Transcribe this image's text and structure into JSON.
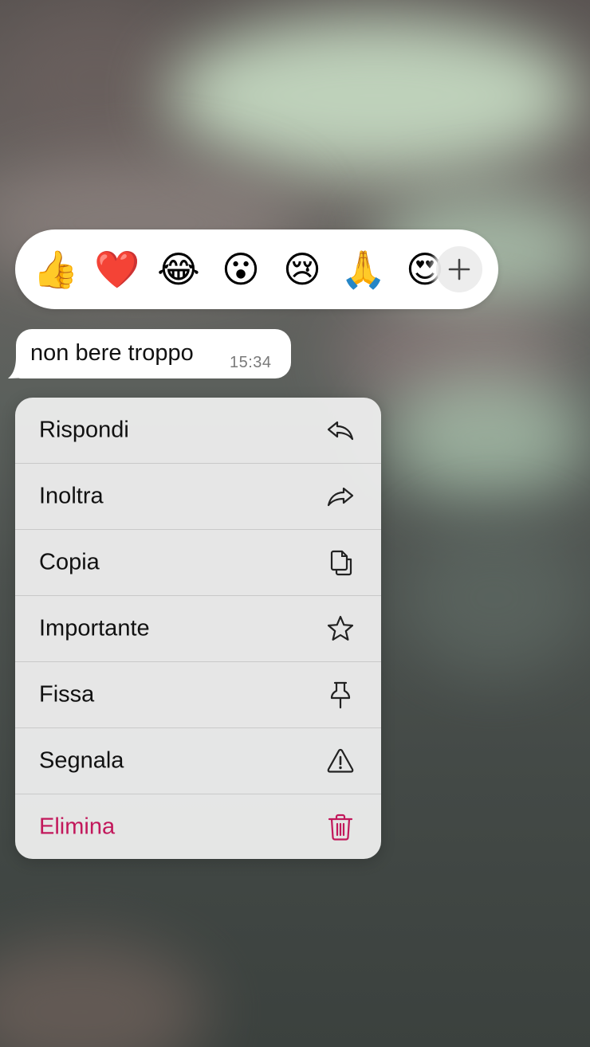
{
  "reactions": {
    "emojis": [
      "👍",
      "❤️",
      "😂",
      "😮",
      "😢",
      "🙏",
      "😍"
    ],
    "more_icon": "plus-icon"
  },
  "message": {
    "text": "non bere troppo",
    "time": "15:34"
  },
  "menu": {
    "items": [
      {
        "label": "Rispondi",
        "icon": "reply-icon"
      },
      {
        "label": "Inoltra",
        "icon": "forward-icon"
      },
      {
        "label": "Copia",
        "icon": "copy-icon"
      },
      {
        "label": "Importante",
        "icon": "star-icon"
      },
      {
        "label": "Fissa",
        "icon": "pin-icon"
      },
      {
        "label": "Segnala",
        "icon": "warning-icon"
      },
      {
        "label": "Elimina",
        "icon": "trash-icon"
      }
    ]
  },
  "colors": {
    "danger": "#c2185b",
    "menu_background": "#ececec",
    "bubble_background": "#ffffff"
  }
}
